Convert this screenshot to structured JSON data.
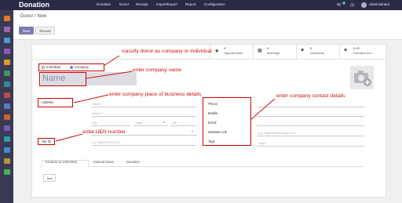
{
  "navbar": {
    "app_title": "Donation",
    "menu": [
      "Donation",
      "Donor",
      "Receipt",
      "Import/Export",
      "Report",
      "Configuration"
    ],
    "badge": "2",
    "user": "Administrator"
  },
  "control": {
    "breadcrumb": "Donor / New",
    "save_label": "Save",
    "discard_label": "Discard"
  },
  "stats": [
    {
      "value": "0",
      "label": "Opportunities",
      "icon": "star-icon"
    },
    {
      "value": "0",
      "label": "Meetings",
      "icon": "calendar-icon"
    },
    {
      "value": "0",
      "label": "Donations",
      "icon": "heart-icon"
    },
    {
      "value": "0.00",
      "label": "Donation Am...",
      "icon": "heart-icon"
    }
  ],
  "form": {
    "type_options": [
      "Individual",
      "Company"
    ],
    "name_placeholder": "Name",
    "address_label": "Address",
    "street_placeholder": "Street...",
    "street2_placeholder": "Street 2...",
    "city_placeholder": "City",
    "state_placeholder": "State",
    "zip_placeholder": "ZIP",
    "country_placeholder": "Country",
    "taxid_label": "Tax ID",
    "taxid_placeholder": "e.g. BE0477472701",
    "phone_label": "Phone",
    "mobile_label": "Mobile",
    "email_label": "Email",
    "website_label": "Website Link",
    "website_placeholder": "e.g. https://www.odoo.com",
    "tags_label": "Tags",
    "tags_placeholder": "Tags..."
  },
  "tabs": [
    "Contacts & Addresses",
    "Internal Notes",
    "Donation"
  ],
  "add_label": "Add",
  "annotations": {
    "classify": "classify donor as company or individual",
    "company_name": "enter company name",
    "place": "enter company place of business details",
    "contact": "enter company contact details",
    "uen": "enter UEN number"
  },
  "colors": {
    "navbar": "#2b2a46",
    "appbar": "#3a3a55",
    "primary": "#7c7bad",
    "annotation": "#c81010"
  }
}
